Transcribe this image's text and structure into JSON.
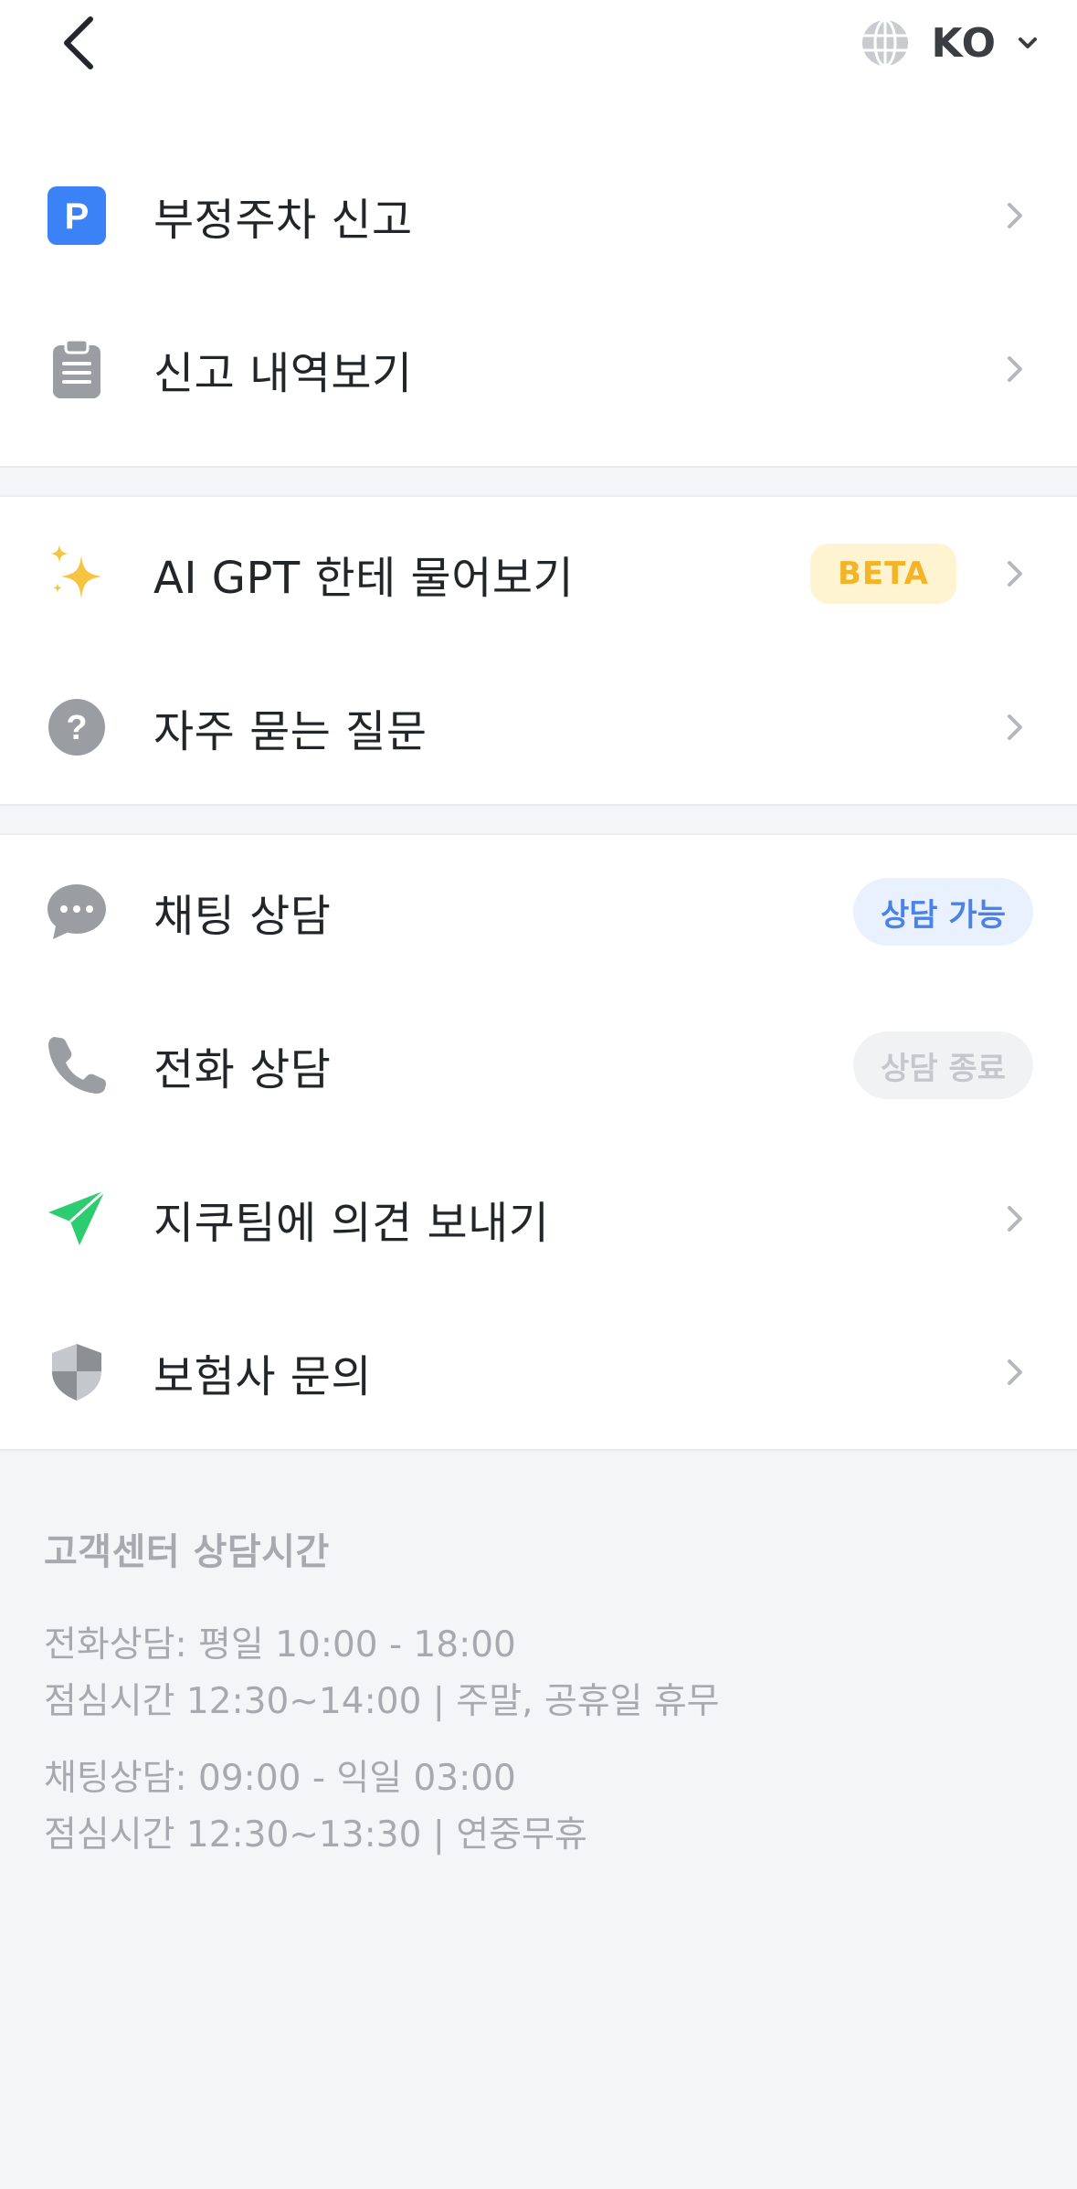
{
  "header": {
    "language": "KO"
  },
  "menu": {
    "parking_report": "부정주차 신고",
    "report_history": "신고 내역보기",
    "ai_gpt": "AI GPT 한테 물어보기",
    "ai_badge": "BETA",
    "faq": "자주 묻는 질문",
    "chat_consult": "채팅 상담",
    "chat_status": "상담 가능",
    "phone_consult": "전화 상담",
    "phone_status": "상담 종료",
    "feedback": "지쿠팀에 의견 보내기",
    "insurance": "보험사 문의"
  },
  "info": {
    "title": "고객센터 상담시간",
    "phone_line1": "전화상담: 평일 10:00 - 18:00",
    "phone_line2": "점심시간 12:30~14:00 | 주말, 공휴일 휴무",
    "chat_line1": "채팅상담: 09:00 - 익일 03:00",
    "chat_line2": "점심시간 12:30~13:30 | 연중무휴"
  },
  "colors": {
    "parking_icon": "#3b82f6",
    "sparkle_icon": "#f5c542",
    "send_icon": "#2ecc71",
    "chat_available": "#4a82e6",
    "beta_text": "#f2b428",
    "beta_bg": "#fff4d1"
  }
}
